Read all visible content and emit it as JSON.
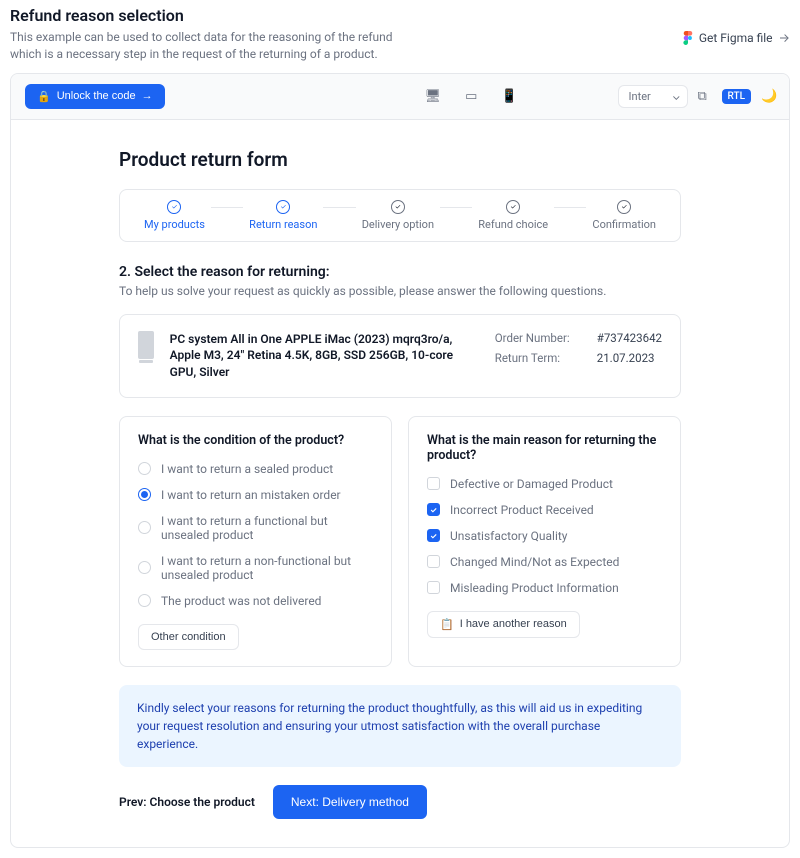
{
  "header": {
    "title": "Refund reason selection",
    "description": "This example can be used to collect data for the reasoning of the refund which is a necessary step in the request of the returning of a product.",
    "figma_link": "Get Figma file"
  },
  "toolbar": {
    "unlock": "Unlock the code",
    "font": "Inter",
    "rtl": "RTL"
  },
  "form": {
    "title": "Product return form",
    "steps": [
      "My products",
      "Return reason",
      "Delivery option",
      "Refund choice",
      "Confirmation"
    ],
    "step_heading": "2. Select the reason for returning:",
    "step_sub": "To help us solve your request as quickly as possible, please answer the following questions."
  },
  "product": {
    "name": "PC system All in One APPLE iMac (2023) mqrq3ro/a, Apple M3, 24\" Retina 4.5K, 8GB, SSD 256GB, 10-core GPU, Silver",
    "order_number_label": "Order Number:",
    "order_number": "#737423642",
    "return_term_label": "Return Term:",
    "return_term": "21.07.2023"
  },
  "q1": {
    "title": "What is the condition of the product?",
    "options": [
      "I want to return a sealed product",
      "I want to return an mistaken order",
      "I want to return a functional but unsealed product",
      "I want to return a non-functional but unsealed product",
      "The product was not delivered"
    ],
    "other": "Other condition"
  },
  "q2": {
    "title": "What is the main reason for returning the product?",
    "options": [
      "Defective or Damaged Product",
      "Incorrect Product Received",
      "Unsatisfactory Quality",
      "Changed Mind/Not as Expected",
      "Misleading Product Information"
    ],
    "other": "I have another reason"
  },
  "banner": "Kindly select your reasons for returning the product thoughtfully, as this will aid us in expediting your request resolution and ensuring your utmost satisfaction with the overall purchase experience.",
  "nav": {
    "prev": "Prev: Choose the product",
    "next": "Next: Delivery method"
  }
}
